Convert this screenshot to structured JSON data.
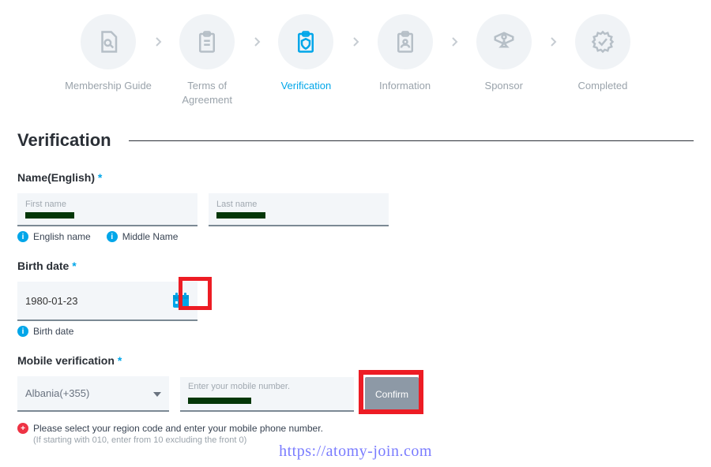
{
  "stepper": {
    "items": [
      {
        "label": "Membership Guide"
      },
      {
        "label": "Terms of Agreement"
      },
      {
        "label": "Verification"
      },
      {
        "label": "Information"
      },
      {
        "label": "Sponsor"
      },
      {
        "label": "Completed"
      }
    ]
  },
  "title": "Verification",
  "name": {
    "label": "Name(English)",
    "first_placeholder": "First name",
    "last_placeholder": "Last name",
    "hint1": "English name",
    "hint2": "Middle Name"
  },
  "birth": {
    "label": "Birth date",
    "value": "1980-01-23",
    "hint": "Birth date"
  },
  "mobile": {
    "label": "Mobile verification",
    "country": "Albania(+355)",
    "placeholder": "Enter your mobile number.",
    "confirm": "Confirm",
    "error": "Please select your region code and enter your mobile phone number.",
    "error_sub": "(If starting with 010, enter from 10 excluding the front 0)"
  },
  "watermark": "https://atomy-join.com"
}
